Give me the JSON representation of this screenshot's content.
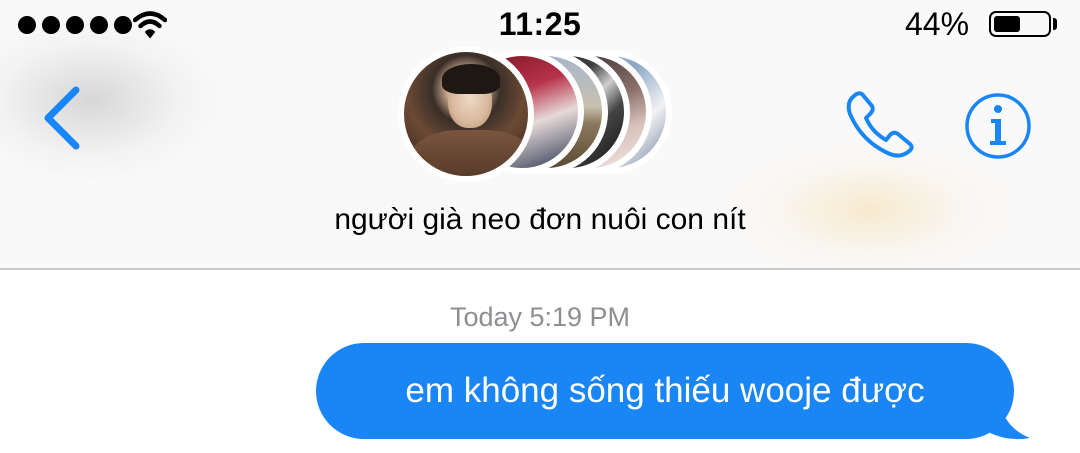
{
  "status_bar": {
    "signal_bars": 5,
    "time": "11:25",
    "battery_percent_label": "44%",
    "battery_level": 0.44
  },
  "nav": {
    "back_icon": "chevron-left-icon",
    "call_icon": "phone-icon",
    "info_icon": "info-circle-icon",
    "accent_color": "#1a86f5"
  },
  "conversation": {
    "group_name": "người già neo đơn nuôi con nít",
    "participant_avatar_count": 6
  },
  "messages": {
    "timestamp": "Today 5:19 PM",
    "items": [
      {
        "direction": "outgoing",
        "text": "em không sống thiếu wooje được",
        "bubble_color": "#1a86f5"
      }
    ]
  }
}
